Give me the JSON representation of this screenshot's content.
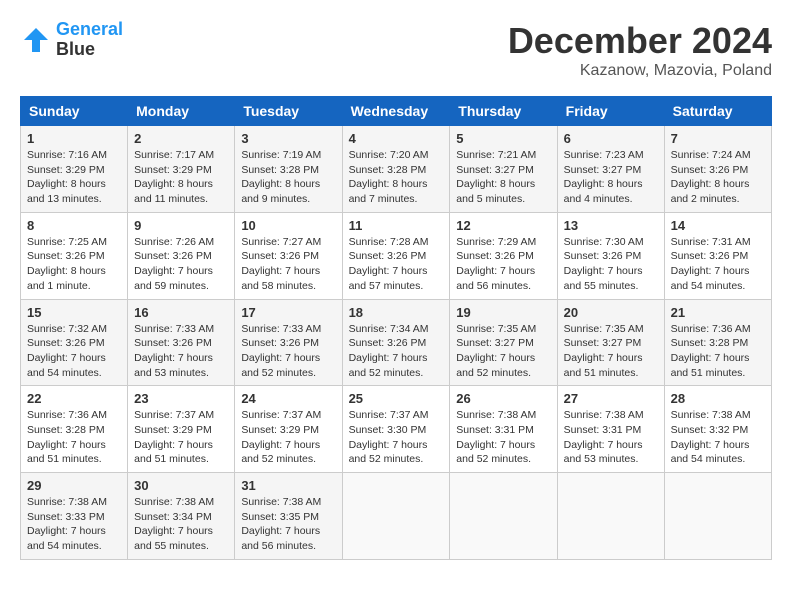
{
  "header": {
    "logo_line1": "General",
    "logo_line2": "Blue",
    "title": "December 2024",
    "subtitle": "Kazanow, Mazovia, Poland"
  },
  "weekdays": [
    "Sunday",
    "Monday",
    "Tuesday",
    "Wednesday",
    "Thursday",
    "Friday",
    "Saturday"
  ],
  "weeks": [
    [
      {
        "day": "1",
        "sunrise": "7:16 AM",
        "sunset": "3:29 PM",
        "daylight": "8 hours and 13 minutes."
      },
      {
        "day": "2",
        "sunrise": "7:17 AM",
        "sunset": "3:29 PM",
        "daylight": "8 hours and 11 minutes."
      },
      {
        "day": "3",
        "sunrise": "7:19 AM",
        "sunset": "3:28 PM",
        "daylight": "8 hours and 9 minutes."
      },
      {
        "day": "4",
        "sunrise": "7:20 AM",
        "sunset": "3:28 PM",
        "daylight": "8 hours and 7 minutes."
      },
      {
        "day": "5",
        "sunrise": "7:21 AM",
        "sunset": "3:27 PM",
        "daylight": "8 hours and 5 minutes."
      },
      {
        "day": "6",
        "sunrise": "7:23 AM",
        "sunset": "3:27 PM",
        "daylight": "8 hours and 4 minutes."
      },
      {
        "day": "7",
        "sunrise": "7:24 AM",
        "sunset": "3:26 PM",
        "daylight": "8 hours and 2 minutes."
      }
    ],
    [
      {
        "day": "8",
        "sunrise": "7:25 AM",
        "sunset": "3:26 PM",
        "daylight": "8 hours and 1 minute."
      },
      {
        "day": "9",
        "sunrise": "7:26 AM",
        "sunset": "3:26 PM",
        "daylight": "7 hours and 59 minutes."
      },
      {
        "day": "10",
        "sunrise": "7:27 AM",
        "sunset": "3:26 PM",
        "daylight": "7 hours and 58 minutes."
      },
      {
        "day": "11",
        "sunrise": "7:28 AM",
        "sunset": "3:26 PM",
        "daylight": "7 hours and 57 minutes."
      },
      {
        "day": "12",
        "sunrise": "7:29 AM",
        "sunset": "3:26 PM",
        "daylight": "7 hours and 56 minutes."
      },
      {
        "day": "13",
        "sunrise": "7:30 AM",
        "sunset": "3:26 PM",
        "daylight": "7 hours and 55 minutes."
      },
      {
        "day": "14",
        "sunrise": "7:31 AM",
        "sunset": "3:26 PM",
        "daylight": "7 hours and 54 minutes."
      }
    ],
    [
      {
        "day": "15",
        "sunrise": "7:32 AM",
        "sunset": "3:26 PM",
        "daylight": "7 hours and 54 minutes."
      },
      {
        "day": "16",
        "sunrise": "7:33 AM",
        "sunset": "3:26 PM",
        "daylight": "7 hours and 53 minutes."
      },
      {
        "day": "17",
        "sunrise": "7:33 AM",
        "sunset": "3:26 PM",
        "daylight": "7 hours and 52 minutes."
      },
      {
        "day": "18",
        "sunrise": "7:34 AM",
        "sunset": "3:26 PM",
        "daylight": "7 hours and 52 minutes."
      },
      {
        "day": "19",
        "sunrise": "7:35 AM",
        "sunset": "3:27 PM",
        "daylight": "7 hours and 52 minutes."
      },
      {
        "day": "20",
        "sunrise": "7:35 AM",
        "sunset": "3:27 PM",
        "daylight": "7 hours and 51 minutes."
      },
      {
        "day": "21",
        "sunrise": "7:36 AM",
        "sunset": "3:28 PM",
        "daylight": "7 hours and 51 minutes."
      }
    ],
    [
      {
        "day": "22",
        "sunrise": "7:36 AM",
        "sunset": "3:28 PM",
        "daylight": "7 hours and 51 minutes."
      },
      {
        "day": "23",
        "sunrise": "7:37 AM",
        "sunset": "3:29 PM",
        "daylight": "7 hours and 51 minutes."
      },
      {
        "day": "24",
        "sunrise": "7:37 AM",
        "sunset": "3:29 PM",
        "daylight": "7 hours and 52 minutes."
      },
      {
        "day": "25",
        "sunrise": "7:37 AM",
        "sunset": "3:30 PM",
        "daylight": "7 hours and 52 minutes."
      },
      {
        "day": "26",
        "sunrise": "7:38 AM",
        "sunset": "3:31 PM",
        "daylight": "7 hours and 52 minutes."
      },
      {
        "day": "27",
        "sunrise": "7:38 AM",
        "sunset": "3:31 PM",
        "daylight": "7 hours and 53 minutes."
      },
      {
        "day": "28",
        "sunrise": "7:38 AM",
        "sunset": "3:32 PM",
        "daylight": "7 hours and 54 minutes."
      }
    ],
    [
      {
        "day": "29",
        "sunrise": "7:38 AM",
        "sunset": "3:33 PM",
        "daylight": "7 hours and 54 minutes."
      },
      {
        "day": "30",
        "sunrise": "7:38 AM",
        "sunset": "3:34 PM",
        "daylight": "7 hours and 55 minutes."
      },
      {
        "day": "31",
        "sunrise": "7:38 AM",
        "sunset": "3:35 PM",
        "daylight": "7 hours and 56 minutes."
      },
      null,
      null,
      null,
      null
    ]
  ]
}
